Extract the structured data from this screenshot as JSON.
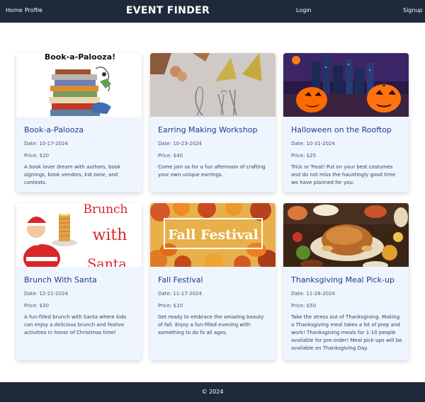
{
  "nav": {
    "home": "Home",
    "profile": "Profile",
    "brand": "EVENT FINDER",
    "login": "Login",
    "signup": "Signup"
  },
  "events": [
    {
      "title": "Book-a-Palooza",
      "date": "Date: 10-17-2024",
      "price": "Price: $20",
      "description": "A book lover dream with authors, book signings, book vendors, kid zone, and contests.",
      "image_text": "Book-a-Palooza!"
    },
    {
      "title": "Earring Making Workshop",
      "date": "Date: 10-23-2024",
      "price": "Price: $40",
      "description": "Come join us for a fun afternoon of crafting your own unique earrings."
    },
    {
      "title": "Halloween on the Rooftop",
      "date": "Date: 10-31-2024",
      "price": "Price: $25",
      "description": "Trick or Treat! Put on your best costumes and do not miss the hauntingly good time we have planned for you."
    },
    {
      "title": "Brunch With Santa",
      "date": "Date: 12-21-2024",
      "price": "Price: $30",
      "description": "A fun-filled brunch with Santa where kids can enjoy a delicious brunch and festive activities in honor of Christmas time!",
      "image_text": [
        "Brunch",
        "with",
        "Santa"
      ]
    },
    {
      "title": "Fall Festival",
      "date": "Date: 11-17-2024",
      "price": "Price: $10",
      "description": "Get ready to embrace the amazing beauty of fall. Enjoy a fun-filled evening with something to do fo all ages.",
      "image_text": "Fall Festival"
    },
    {
      "title": "Thanksgiving Meal Pick-up",
      "date": "Date: 11-28-2024",
      "price": "Price: $50",
      "description": "Take the stress out of Thanksgiving. Making a Thanksgiving meal takes a lot of prep and work! Thanksgiving meals for 1-10 people available for pre-order! Meal pick-ups will be available on Thanksgiving Day."
    }
  ],
  "footer": {
    "text": "© 2024"
  },
  "colors": {
    "navbar": "#1e293b",
    "card_bg": "#eef5fe",
    "title": "#1e3a8a"
  }
}
